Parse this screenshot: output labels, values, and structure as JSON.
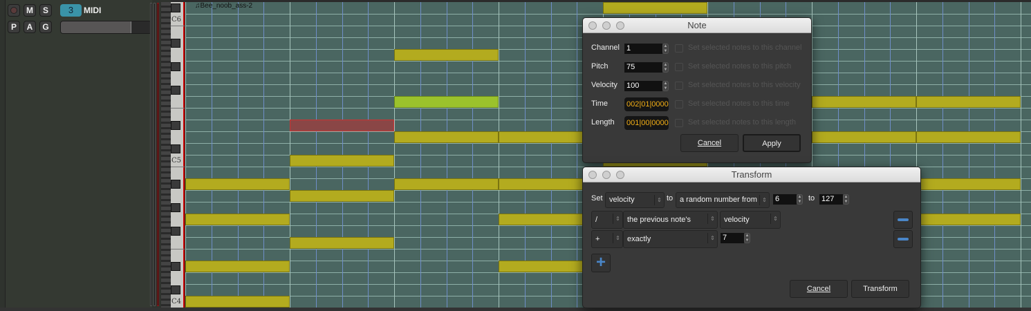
{
  "track": {
    "record_icon": "record-icon",
    "mute": "M",
    "solo": "S",
    "number": "3",
    "name": "MIDI",
    "p": "P",
    "a": "A",
    "g": "G",
    "volume_fraction": 0.78
  },
  "region": {
    "name": "♫Bee_noob_ass-2"
  },
  "keyboard": {
    "labels": [
      "C6",
      "C5",
      "C4"
    ]
  },
  "colors": {
    "note": "#b3ab1f",
    "note_selected": "#8a4646",
    "note_green": "#9bc22c",
    "grid": "#4a6661"
  },
  "notes": [
    {
      "pitch": 85,
      "bar": 5,
      "bars": 1,
      "state": "normal"
    },
    {
      "pitch": 81,
      "bar": 3,
      "bars": 1,
      "state": "normal"
    },
    {
      "pitch": 77,
      "bar": 3,
      "bars": 1,
      "state": "green"
    },
    {
      "pitch": 77,
      "bar": 7,
      "bars": 1,
      "state": "normal"
    },
    {
      "pitch": 77,
      "bar": 8,
      "bars": 1,
      "state": "normal"
    },
    {
      "pitch": 75,
      "bar": 2,
      "bars": 1,
      "state": "selected"
    },
    {
      "pitch": 74,
      "bar": 3,
      "bars": 1,
      "state": "normal"
    },
    {
      "pitch": 74,
      "bar": 4,
      "bars": 1,
      "state": "normal"
    },
    {
      "pitch": 74,
      "bar": 7,
      "bars": 1,
      "state": "normal"
    },
    {
      "pitch": 74,
      "bar": 8,
      "bars": 1,
      "state": "normal"
    },
    {
      "pitch": 72,
      "bar": 2,
      "bars": 1,
      "state": "normal"
    },
    {
      "pitch": 72,
      "bar": 5,
      "bars": 1,
      "state": "normal"
    },
    {
      "pitch": 70,
      "bar": 1,
      "bars": 1,
      "state": "normal"
    },
    {
      "pitch": 70,
      "bar": 3,
      "bars": 1,
      "state": "normal"
    },
    {
      "pitch": 70,
      "bar": 4,
      "bars": 1,
      "state": "normal"
    },
    {
      "pitch": 70,
      "bar": 8,
      "bars": 1,
      "state": "normal"
    },
    {
      "pitch": 69,
      "bar": 2,
      "bars": 1,
      "state": "normal"
    },
    {
      "pitch": 67,
      "bar": 1,
      "bars": 1,
      "state": "normal"
    },
    {
      "pitch": 67,
      "bar": 4,
      "bars": 1,
      "state": "normal"
    },
    {
      "pitch": 67,
      "bar": 8,
      "bars": 1,
      "state": "normal"
    },
    {
      "pitch": 65,
      "bar": 2,
      "bars": 1,
      "state": "normal"
    },
    {
      "pitch": 63,
      "bar": 1,
      "bars": 1,
      "state": "normal"
    },
    {
      "pitch": 63,
      "bar": 4,
      "bars": 1,
      "state": "normal"
    },
    {
      "pitch": 60,
      "bar": 1,
      "bars": 1,
      "state": "normal"
    }
  ],
  "note_dialog": {
    "title": "Note",
    "channel_label": "Channel",
    "channel": "1",
    "channel_check": "Set selected notes to this channel",
    "pitch_label": "Pitch",
    "pitch": "75",
    "pitch_check": "Set selected notes to this pitch",
    "velocity_label": "Velocity",
    "velocity": "100",
    "velocity_check": "Set selected notes to this velocity",
    "time_label": "Time",
    "time": "002|01|0000",
    "time_check": "Set selected notes to this time",
    "length_label": "Length",
    "length": "001|00|0000",
    "length_check": "Set selected notes to this length",
    "cancel": "Cancel",
    "apply": "Apply"
  },
  "transform_dialog": {
    "title": "Transform",
    "set_label": "Set",
    "property": "velocity",
    "to_label": "to",
    "source": "a random number from",
    "from_value": "6",
    "to2_label": "to",
    "to_value": "127",
    "rows": [
      {
        "op": "/",
        "source": "the previous note's",
        "value": "velocity"
      },
      {
        "op": "+",
        "source": "exactly",
        "value": "7"
      }
    ],
    "cancel": "Cancel",
    "transform": "Transform"
  }
}
